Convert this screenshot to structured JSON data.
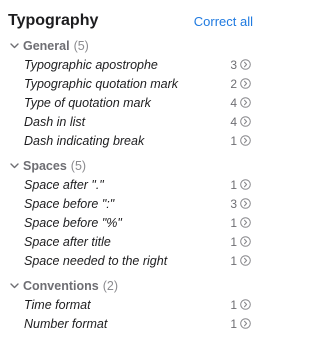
{
  "header": {
    "title": "Typography",
    "correct_all_label": "Correct all"
  },
  "groups": [
    {
      "name": "General",
      "count": "(5)",
      "items": [
        {
          "label": "Typographic apostrophe",
          "count": "3"
        },
        {
          "label": "Typographic quotation mark",
          "count": "2"
        },
        {
          "label": "Type of quotation mark",
          "count": "4"
        },
        {
          "label": "Dash in list",
          "count": "4"
        },
        {
          "label": "Dash indicating break",
          "count": "1"
        }
      ]
    },
    {
      "name": "Spaces",
      "count": "(5)",
      "items": [
        {
          "label": "Space after \".\"",
          "count": "1"
        },
        {
          "label": "Space before \":\"",
          "count": "3"
        },
        {
          "label": "Space before \"%\"",
          "count": "1"
        },
        {
          "label": "Space after title",
          "count": "1"
        },
        {
          "label": "Space needed to the right",
          "count": "1"
        }
      ]
    },
    {
      "name": "Conventions",
      "count": "(2)",
      "items": [
        {
          "label": "Time format",
          "count": "1"
        },
        {
          "label": "Number format",
          "count": "1"
        }
      ]
    }
  ],
  "colors": {
    "accent": "#1f7ae0",
    "group_text": "#6e6e73",
    "item_text": "#1d1d1f"
  },
  "icons": {
    "group_toggle": "chevron-down-icon",
    "item_action": "circled-arrow-right-icon"
  }
}
